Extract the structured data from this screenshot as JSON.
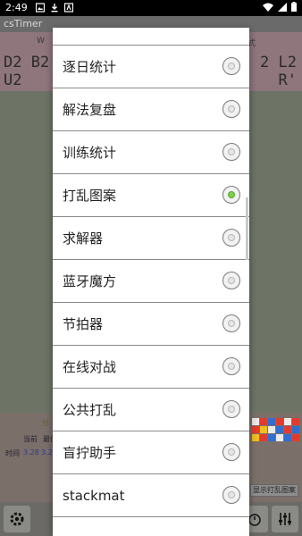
{
  "status_bar": {
    "time": "2:49"
  },
  "app": {
    "title": "csTimer",
    "scramble_left": "D2 B2\nU2",
    "scramble_right": "2 L2\nR'",
    "scramble_tiny": "W",
    "scramble_tiny_right": "式"
  },
  "stats": {
    "label_top": "分",
    "label_current": "当前",
    "label_best": "最佳",
    "label_time": "时间",
    "value_current": "3.28",
    "value_best": "3.28",
    "scramble_image_button": "显示打乱图案"
  },
  "menu": {
    "items": [
      {
        "label": "逐日统计",
        "checked": false
      },
      {
        "label": "解法复盘",
        "checked": false
      },
      {
        "label": "训练统计",
        "checked": false
      },
      {
        "label": "打乱图案",
        "checked": true
      },
      {
        "label": "求解器",
        "checked": false
      },
      {
        "label": "蓝牙魔方",
        "checked": false
      },
      {
        "label": "节拍器",
        "checked": false
      },
      {
        "label": "在线对战",
        "checked": false
      },
      {
        "label": "公共打乱",
        "checked": false
      },
      {
        "label": "盲拧助手",
        "checked": false
      },
      {
        "label": "stackmat",
        "checked": false
      }
    ]
  },
  "colors": {
    "accent_checked": "#7bd24a",
    "menu_background": "#ffffff",
    "divider": "#8a8a8a"
  }
}
